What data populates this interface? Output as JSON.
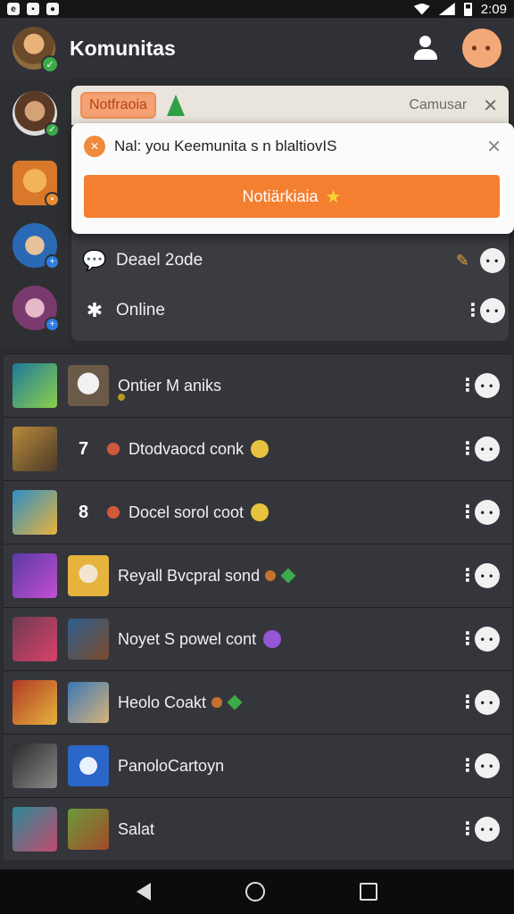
{
  "status_bar": {
    "time": "2:09",
    "left_icons": [
      "app-icon",
      "image-icon",
      "message-icon"
    ],
    "right_icons": [
      "wifi-icon",
      "signal-icon",
      "battery-icon"
    ]
  },
  "app_bar": {
    "title": "Komunitas",
    "actions": [
      "add-user-icon",
      "profile-avatar"
    ]
  },
  "back_banner": {
    "tag": "Notfraoia",
    "cancel_label": "Camusar"
  },
  "popup": {
    "message": "Nal: you Keemunita s n blaltiovIS",
    "button_label": "Notiärkiaia"
  },
  "panel_rows": [
    {
      "label": "Deael 2ode",
      "icon": "chat-bubble-icon",
      "end_icon": "pencil-icon"
    },
    {
      "label": "Online",
      "icon": "puzzle-icon",
      "end_icon": "kebab-icon"
    }
  ],
  "list": [
    {
      "label": "Ontier M aniks",
      "rank": "",
      "extra": "sub-dot",
      "thumb_color": "#1d7a9a",
      "thumb2_color": "#6b5a48"
    },
    {
      "label": "Dtodvaocd conk",
      "rank": "7",
      "extra": "emoji",
      "thumb_color": "#b98b3a",
      "thumb2_color": ""
    },
    {
      "label": "Docel sorol coot",
      "rank": "8",
      "extra": "emoji",
      "thumb_color": "#2d8fc4",
      "thumb2_color": ""
    },
    {
      "label": "Reyall Bvcpral sond",
      "rank": "",
      "extra": "nut-gem",
      "thumb_color": "#5a3aa6",
      "thumb2_color": "#e6b33d"
    },
    {
      "label": "Noyet S powel cont",
      "rank": "",
      "extra": "emoji-purple",
      "thumb_color": "#6e3b52",
      "thumb2_color": "#2d5e8e"
    },
    {
      "label": "Heolo Coakt",
      "rank": "",
      "extra": "nut-gem",
      "thumb_color": "#b23a25",
      "thumb2_color": "#3b78b5"
    },
    {
      "label": "PanoloCartoyn",
      "rank": "",
      "extra": "",
      "thumb_color": "#2a2a2a",
      "thumb2_color": "#2b66c9"
    },
    {
      "label": "Salat",
      "rank": "",
      "extra": "",
      "thumb_color": "#2a8a97",
      "thumb2_color": "#6b9a3a"
    }
  ],
  "navigation": [
    "back-icon",
    "home-icon",
    "recents-icon"
  ],
  "colors": {
    "accent": "#f47f30",
    "background": "#2b2c30",
    "online": "#3caa49"
  }
}
